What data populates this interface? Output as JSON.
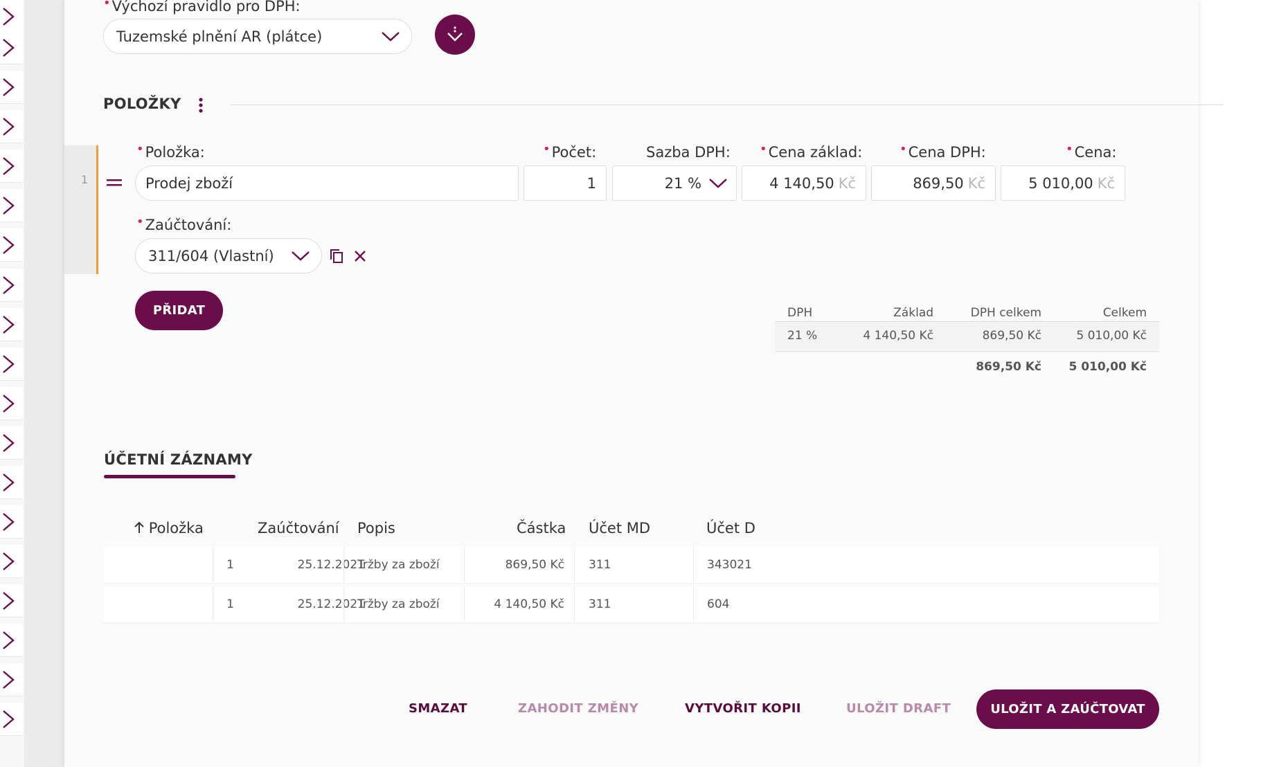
{
  "vat_rule": {
    "label": "Výchozí pravidlo pro DPH:",
    "value": "Tuzemské plnění AR (plátce)"
  },
  "items_section": {
    "title": "POLOŽKY"
  },
  "item_row": {
    "index": "1",
    "labels": {
      "item": "Položka:",
      "count": "Počet:",
      "vat_rate": "Sazba DPH:",
      "price_base": "Cena základ:",
      "price_vat": "Cena DPH:",
      "price": "Cena:",
      "posting": "Zaúčtování:"
    },
    "item": "Prodej zboží",
    "count": "1",
    "vat_rate": "21 %",
    "price_base": "4 140,50",
    "price_vat": "869,50",
    "price": "5 010,00",
    "currency": "Kč",
    "posting": "311/604 (Vlastní)"
  },
  "add_button": "PŘIDAT",
  "vat_summary": {
    "headers": [
      "DPH",
      "Základ",
      "DPH celkem",
      "Celkem"
    ],
    "rows": [
      [
        "21 %",
        "4 140,50 Kč",
        "869,50 Kč",
        "5 010,00 Kč"
      ]
    ],
    "total_vat": "869,50 Kč",
    "total": "5 010,00 Kč"
  },
  "accounting": {
    "tab": "ÚČETNÍ ZÁZNAMY",
    "headers": [
      "Položka",
      "Zaúčtování",
      "Popis",
      "Částka",
      "Účet MD",
      "Účet D"
    ],
    "rows": [
      [
        "1",
        "25.12.2021",
        "Tržby za zboží",
        "869,50 Kč",
        "311",
        "343021"
      ],
      [
        "1",
        "25.12.2021",
        "Tržby za zboží",
        "4 140,50 Kč",
        "311",
        "604"
      ]
    ]
  },
  "actions": {
    "delete": "SMAZAT",
    "discard": "ZAHODIT ZMĚNY",
    "copy": "VYTVOŘIT KOPII",
    "draft": "ULOŽIT DRAFT",
    "save_post": "ULOŽIT A ZAÚČTOVAT"
  },
  "colors": {
    "accent": "#6b0d4a",
    "required": "#d81e5b",
    "row_marker": "#f0a030"
  },
  "icons": {
    "sidebar": "chevron-right-icon",
    "vat_rule_action": "arrow-down-circle-icon",
    "section_menu": "more-vertical-icon",
    "drag": "drag-handle-icon",
    "copy": "copy-icon",
    "remove": "close-icon",
    "sort": "arrow-up-icon"
  }
}
